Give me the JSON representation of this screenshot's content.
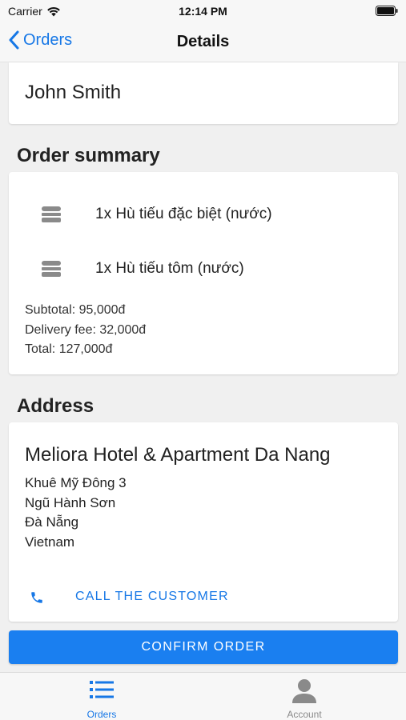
{
  "status_bar": {
    "carrier": "Carrier",
    "time": "12:14 PM"
  },
  "nav": {
    "back_label": "Orders",
    "title": "Details"
  },
  "customer": {
    "name": "John Smith"
  },
  "order_summary": {
    "title": "Order summary",
    "items": [
      {
        "label": "1x Hù tiếu đặc biệt (nước)",
        "icon": "food-icon"
      },
      {
        "label": "1x Hù tiếu tôm (nước)",
        "icon": "food-icon"
      }
    ],
    "subtotal": "Subtotal: 95,000đ",
    "delivery_fee": "Delivery fee: 32,000đ",
    "total": "Total: 127,000đ"
  },
  "address": {
    "title": "Address",
    "name": "Meliora Hotel & Apartment Da Nang",
    "lines": [
      "Khuê Mỹ Đông 3",
      "Ngũ Hành Sơn",
      "Đà Nẵng",
      "Vietnam"
    ],
    "call_label": "CALL THE CUSTOMER"
  },
  "confirm_label": "CONFIRM ORDER",
  "tabs": [
    {
      "label": "Orders",
      "icon": "list-icon",
      "active": true
    },
    {
      "label": "Account",
      "icon": "person-icon",
      "active": false
    }
  ],
  "colors": {
    "accent": "#1677e6",
    "button": "#1a7ff0",
    "background": "#f0f0f0",
    "inactive_tab": "#8a8a8a"
  }
}
